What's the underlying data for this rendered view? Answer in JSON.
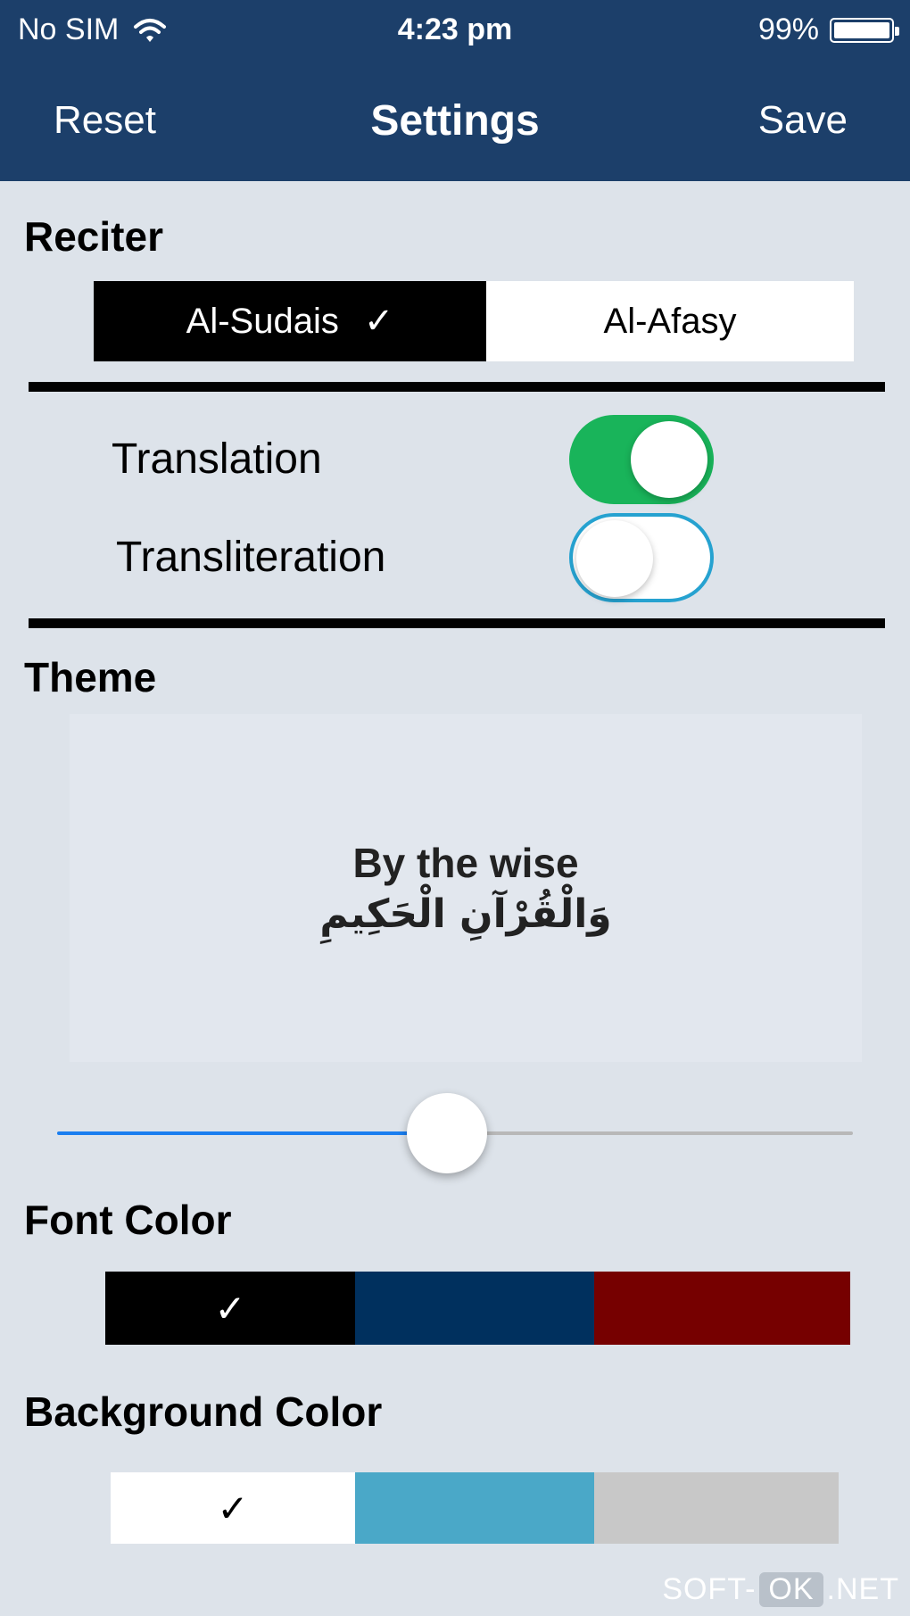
{
  "status_bar": {
    "carrier": "No SIM",
    "wifi_icon": "wifi-icon",
    "time": "4:23 pm",
    "battery": "99%",
    "battery_level": 0.99
  },
  "nav": {
    "left": "Reset",
    "title": "Settings",
    "right": "Save",
    "background": "#1c3f6a"
  },
  "reciter": {
    "title": "Reciter",
    "options": [
      {
        "label": "Al-Sudais",
        "check": "✓",
        "selected": true
      },
      {
        "label": "Al-Afasy",
        "check": "",
        "selected": false
      }
    ]
  },
  "toggles": [
    {
      "label": "Translation",
      "on": true,
      "color": "#19b45a"
    },
    {
      "label": "Transliteration",
      "on": false,
      "color": "#26a2d0"
    }
  ],
  "theme": {
    "title": "Theme",
    "preview_line1": "By the wise",
    "preview_line2": "وَالْقُرْآنِ الْحَكِيمِ"
  },
  "font_slider": {
    "value": 0.49
  },
  "font_color": {
    "title": "Font Color",
    "swatches": [
      {
        "color": "#000000",
        "check": "✓",
        "selected": true
      },
      {
        "color": "#00305e",
        "check": "",
        "selected": false
      },
      {
        "color": "#760000",
        "check": "",
        "selected": false
      }
    ]
  },
  "background_color": {
    "title": "Background Color",
    "swatches": [
      {
        "color": "#ffffff",
        "check": "✓",
        "selected": true
      },
      {
        "color": "#4aa8c8",
        "check": "",
        "selected": false
      },
      {
        "color": "#c8c8c8",
        "check": "",
        "selected": false
      }
    ]
  },
  "watermark": {
    "left": "SOFT-",
    "mid": "OK",
    "right": ".NET"
  }
}
